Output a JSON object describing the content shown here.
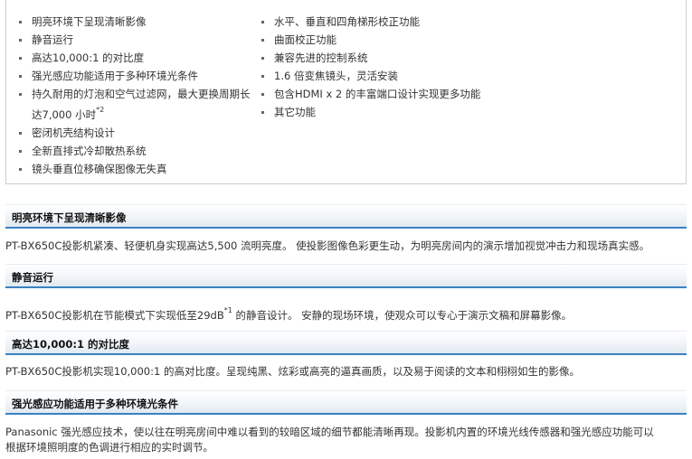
{
  "features": {
    "left": [
      {
        "text": "明亮环境下呈现清晰影像"
      },
      {
        "text": "静音运行"
      },
      {
        "text": "高达10,000:1 的对比度"
      },
      {
        "text": "强光感应功能适用于多种环境光条件"
      },
      {
        "text": "持久耐用的灯泡和空气过滤网，最大更换周期长",
        "cont": "达7,000 小时",
        "sup": "*2"
      },
      {
        "text": "密闭机壳结构设计"
      },
      {
        "text": "全新直排式冷却散热系统"
      },
      {
        "text": "镜头垂直位移确保图像无失真"
      }
    ],
    "right": [
      {
        "text": "水平、垂直和四角梯形校正功能"
      },
      {
        "text": "曲面校正功能"
      },
      {
        "text": "兼容先进的控制系统"
      },
      {
        "text": "1.6 倍变焦镜头，灵活安装"
      },
      {
        "text": "包含HDMI x 2 的丰富端口设计实现更多功能"
      },
      {
        "text": "其它功能"
      }
    ]
  },
  "sections": [
    {
      "title": "明亮环境下呈现清晰影像",
      "text": "PT-BX650C投影机紧凑、轻便机身实现高达5,500 流明亮度。 使投影图像色彩更生动，为明亮房间内的演示增加视觉冲击力和现场真实感。"
    },
    {
      "title": "静音运行",
      "text_a": "PT-BX650C投影机在节能模式下实现低至29dB",
      "sup": "*1",
      "text_b": " 的静音设计。 安静的现场环境，使观众可以专心于演示文稿和屏幕影像。"
    },
    {
      "title": "高达10,000:1 的对比度",
      "text": "PT-BX650C投影机实现10,000:1 的高对比度。呈现纯黑、炫彩或高亮的逼真画质，以及易于阅读的文本和栩栩如生的影像。"
    },
    {
      "title": "强光感应功能适用于多种环境光条件",
      "text_l1": "Panasonic 强光感应技术，使以往在明亮房间中难以看到的较暗区域的细节都能清晰再现。投影机内置的环境光线传感器和强光感应功能可以",
      "text_l2": "根据环境照明度的色调进行相应的实时调节。"
    }
  ],
  "colors": {
    "accent": "#3a82c4",
    "border": "#c9cfd6"
  }
}
